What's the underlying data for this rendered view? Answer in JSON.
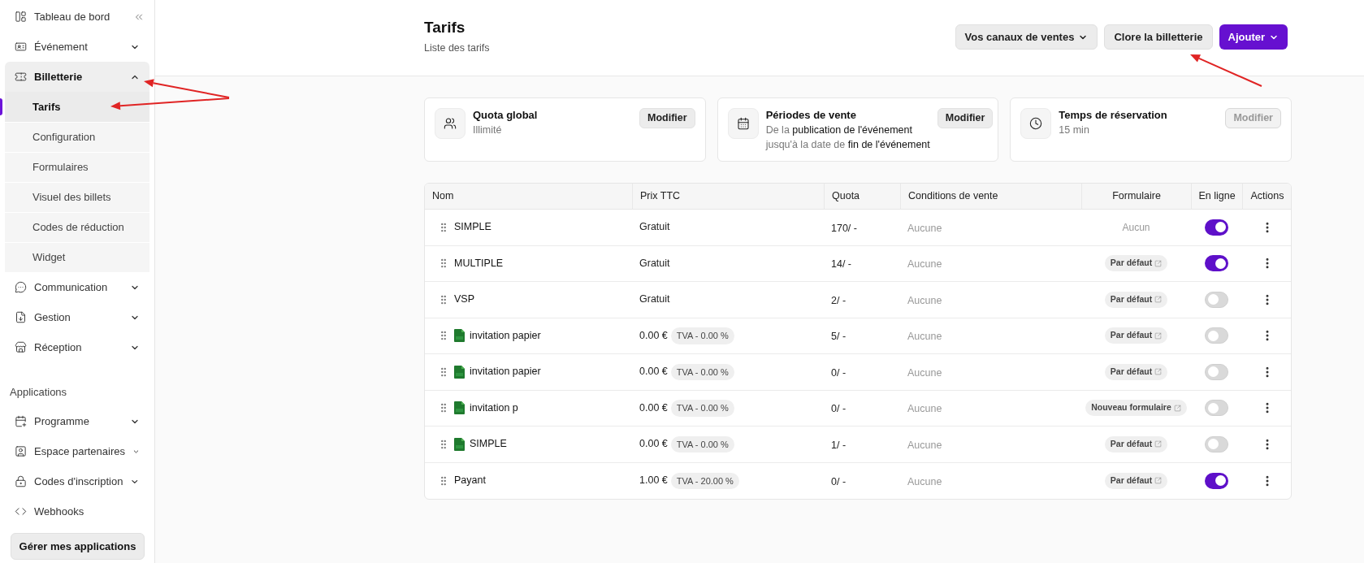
{
  "sidebar": {
    "items": [
      {
        "label": "Tableau de bord"
      },
      {
        "label": "Événement",
        "expanded": false
      },
      {
        "label": "Billetterie",
        "expanded": true,
        "children": [
          {
            "label": "Tarifs",
            "selected": true
          },
          {
            "label": "Configuration",
            "selected": false
          },
          {
            "label": "Formulaires",
            "selected": false
          },
          {
            "label": "Visuel des billets",
            "selected": false
          },
          {
            "label": "Codes de réduction",
            "selected": false
          },
          {
            "label": "Widget",
            "selected": false
          }
        ]
      },
      {
        "label": "Communication",
        "expanded": false
      },
      {
        "label": "Gestion",
        "expanded": false
      },
      {
        "label": "Réception",
        "expanded": false
      }
    ],
    "section_title": "Applications",
    "apps": [
      {
        "label": "Programme",
        "expanded": false
      },
      {
        "label": "Espace partenaires",
        "expanded": false
      },
      {
        "label": "Codes d'inscription",
        "expanded": false
      },
      {
        "label": "Webhooks"
      }
    ],
    "manage_button": "Gérer mes applications"
  },
  "header": {
    "title": "Tarifs",
    "subtitle": "Liste des tarifs",
    "buttons": [
      {
        "label": "Vos canaux de ventes",
        "kind": "secondary",
        "caret": true
      },
      {
        "label": "Clore la billetterie",
        "kind": "secondary",
        "caret": false
      },
      {
        "label": "Ajouter",
        "kind": "primary",
        "caret": true
      }
    ]
  },
  "cards": [
    {
      "title": "Quota global",
      "lines": [
        "Illimité"
      ],
      "button": "Modifier",
      "disabled": false
    },
    {
      "title": "Périodes de vente",
      "lines": [
        "De la **publication de l'événement**",
        "jusqu'à la date de **fin de l'événement**"
      ],
      "button": "Modifier",
      "disabled": false
    },
    {
      "title": "Temps de réservation",
      "lines": [
        "15 min"
      ],
      "button": "Modifier",
      "disabled": true
    }
  ],
  "table": {
    "columns": [
      "Nom",
      "Prix TTC",
      "Quota",
      "Conditions de vente",
      "Formulaire",
      "En ligne",
      "Actions"
    ],
    "rows": [
      {
        "name": "SIMPLE",
        "csv": false,
        "price": "Gratuit",
        "quota": "170/ -",
        "conditions": "Aucune",
        "form": {
          "label": "Aucun",
          "linked": false
        },
        "online": true
      },
      {
        "name": "MULTIPLE",
        "csv": false,
        "price": "Gratuit",
        "quota": "14/ -",
        "conditions": "Aucune",
        "form": {
          "label": "Par défaut",
          "linked": true
        },
        "online": true
      },
      {
        "name": "VSP",
        "csv": false,
        "price": "Gratuit",
        "quota": "2/ -",
        "conditions": "Aucune",
        "form": {
          "label": "Par défaut",
          "linked": true
        },
        "online": false
      },
      {
        "name": "invitation papier",
        "csv": true,
        "price": "0.00 €",
        "vat": "TVA - 0.00 %",
        "quota": "5/ -",
        "conditions": "Aucune",
        "form": {
          "label": "Par défaut",
          "linked": true
        },
        "online": false
      },
      {
        "name": "invitation papier",
        "csv": true,
        "price": "0.00 €",
        "vat": "TVA - 0.00 %",
        "quota": "0/ -",
        "conditions": "Aucune",
        "form": {
          "label": "Par défaut",
          "linked": true
        },
        "online": false
      },
      {
        "name": "invitation p",
        "csv": true,
        "price": "0.00 €",
        "vat": "TVA - 0.00 %",
        "quota": "0/ -",
        "conditions": "Aucune",
        "form": {
          "label": "Nouveau formulaire",
          "linked": true
        },
        "online": false
      },
      {
        "name": "SIMPLE",
        "csv": true,
        "price": "0.00 €",
        "vat": "TVA - 0.00 %",
        "quota": "1/ -",
        "conditions": "Aucune",
        "form": {
          "label": "Par défaut",
          "linked": true
        },
        "online": false
      },
      {
        "name": "Payant",
        "csv": false,
        "price": "1.00 €",
        "vat": "TVA - 20.00 %",
        "quota": "0/ -",
        "conditions": "Aucune",
        "form": {
          "label": "Par défaut",
          "linked": true
        },
        "online": true
      }
    ]
  }
}
